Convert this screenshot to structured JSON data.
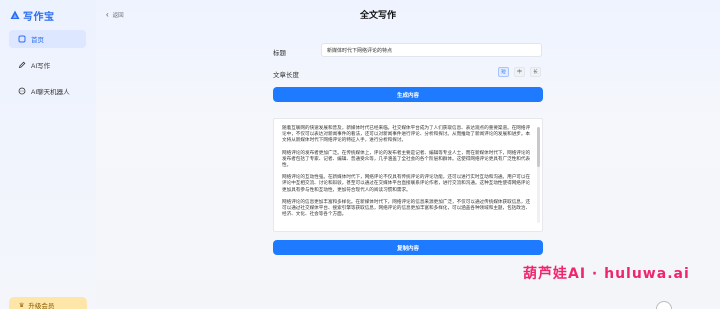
{
  "app": {
    "logo_text": "写作宝"
  },
  "sidebar": {
    "items": [
      {
        "label": "首页",
        "icon": "home-icon",
        "active": true
      },
      {
        "label": "AI写作",
        "icon": "pen-icon",
        "active": false
      },
      {
        "label": "AI聊天机器人",
        "icon": "chat-icon",
        "active": false
      }
    ],
    "upgrade_label": "升级会员"
  },
  "header": {
    "back_label": "返回",
    "title": "全文写作"
  },
  "form": {
    "title_label": "标题",
    "title_value": "新媒体时代下网络评论的特点",
    "length_label": "文章长度",
    "length_options": [
      "短",
      "中",
      "长"
    ],
    "length_selected": "短",
    "generate_label": "生成内容",
    "copy_label": "复制内容"
  },
  "output": {
    "paragraphs": [
      "随着互联网的快速发展和普及，新媒体时代已经来临。社交媒体平台成为了人们获取信息、表达观点的重要渠道。在网络评论中，不仅可以表达对新闻事件的看法，还可以对新闻事件进行评论、分析和探讨。从而推动了新闻评论的发展和进步。本文将从新媒体时代下网络评论的特征入手，进行分析和探讨。",
      "网络评论的发布者更加广泛。在传统媒体上，评论的发布者主要是记者、编辑等专业人士，而在新媒体时代下，网络评论的发布者包括了专家、记者、编辑、普通受众等，几乎涵盖了全社会的各个阶层和群体。这使得网络评论更具有广泛性和代表性。",
      "网络评论的互动性强。在新媒体时代下，网络评论不仅具有传统评论的评论功能，还可以进行实时互动和沟通。用户可以在评论中互相交流、讨论和辩驳，甚至可以通过在交媒体平台直接联系评论作者，进行交流和沟通。这种互动性使得网络评论更加具有参与性和互动性，更加符合现代人的阅读习惯和需求。",
      "网络评论的信息更加丰富和多样化。在新媒体时代下，网络评论的信息来源更加广泛，不仅可以通过传统媒体获取信息，还可以通过社交媒体平台、搜索引擎等获取信息，网络评论的信息更加丰富和多样化，可以涵盖各种领域和主题，包括政治、经济、文化、社会等各个方面。"
    ]
  },
  "watermark": {
    "text": "葫芦娃AI · huluwa.ai"
  },
  "colors": {
    "accent": "#1e7bff",
    "brand": "#2a6df4",
    "watermark": "#f0266d"
  }
}
